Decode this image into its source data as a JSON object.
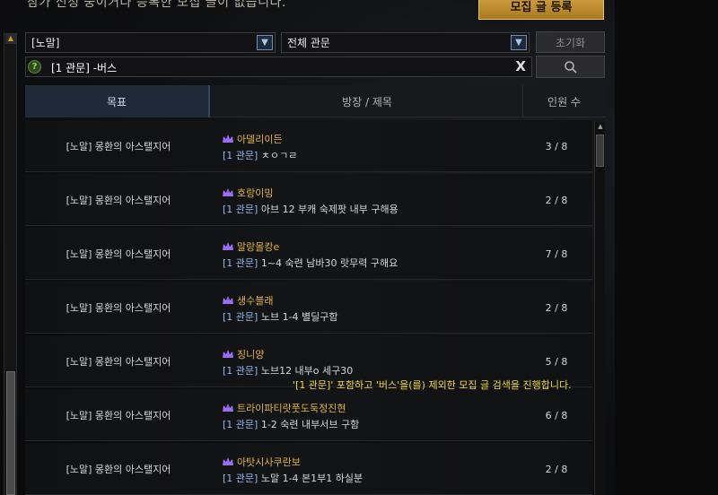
{
  "top": {
    "notice": "참가 신청 중이거나 등록한 모집 글이 없습니다.",
    "register_label": "모집 글 등록"
  },
  "filters": {
    "difficulty": "[노말]",
    "category": "전체 관문",
    "reset_label": "초기화",
    "search_value": "[1 관문] -버스",
    "help_icon": "?",
    "clear_icon": "X"
  },
  "table": {
    "headers": {
      "goal": "목표",
      "title": "방장 / 제목",
      "count": "인원 수"
    },
    "rows": [
      {
        "goal": "[노말] 몽환의 아스탤지어",
        "host": "아델리이든",
        "tag": "[1 관문]",
        "title": "ㅊㅇㄱㄹ",
        "count": "3 / 8"
      },
      {
        "goal": "[노말] 몽환의 아스탤지어",
        "host": "호랑이밍",
        "tag": "[1 관문]",
        "title": "아브 12 부캐 숙제팟 내부 구해용",
        "count": "2 / 8"
      },
      {
        "goal": "[노말] 몽환의 아스탤지어",
        "host": "말랑몰캉e",
        "tag": "[1 관문]",
        "title": "1~4 숙련 남바30 랏무력 구해요",
        "count": "7 / 8"
      },
      {
        "goal": "[노말] 몽환의 아스탤지어",
        "host": "생수블래",
        "tag": "[1 관문]",
        "title": "노브 1-4 별딜구함",
        "count": "2 / 8"
      },
      {
        "goal": "[노말] 몽환의 아스탤지어",
        "host": "징니양",
        "tag": "[1 관문]",
        "title": "노브12 내부o 세구30",
        "count": "5 / 8"
      },
      {
        "goal": "[노말] 몽환의 아스탤지어",
        "host": "트라이파티랏풋도둑정진현",
        "tag": "[1 관문]",
        "title": "1-2 숙련 내부서브 구함",
        "count": "6 / 8"
      },
      {
        "goal": "[노말] 몽환의 아스탤지어",
        "host": "아탓시사쿠란보",
        "tag": "[1 관문]",
        "title": "노말 1-4 본1부1 하실분",
        "count": "2 / 8"
      }
    ]
  },
  "tooltip": "'[1 관문]' 포함하고 '버스'을(를) 제외한 모집 글 검색을 진행합니다.",
  "colors": {
    "accent_gold": "#e0b44a",
    "tag_blue": "#8fb6ea",
    "tooltip_yellow": "#efd64a",
    "register_gold": "#c99a3a"
  }
}
